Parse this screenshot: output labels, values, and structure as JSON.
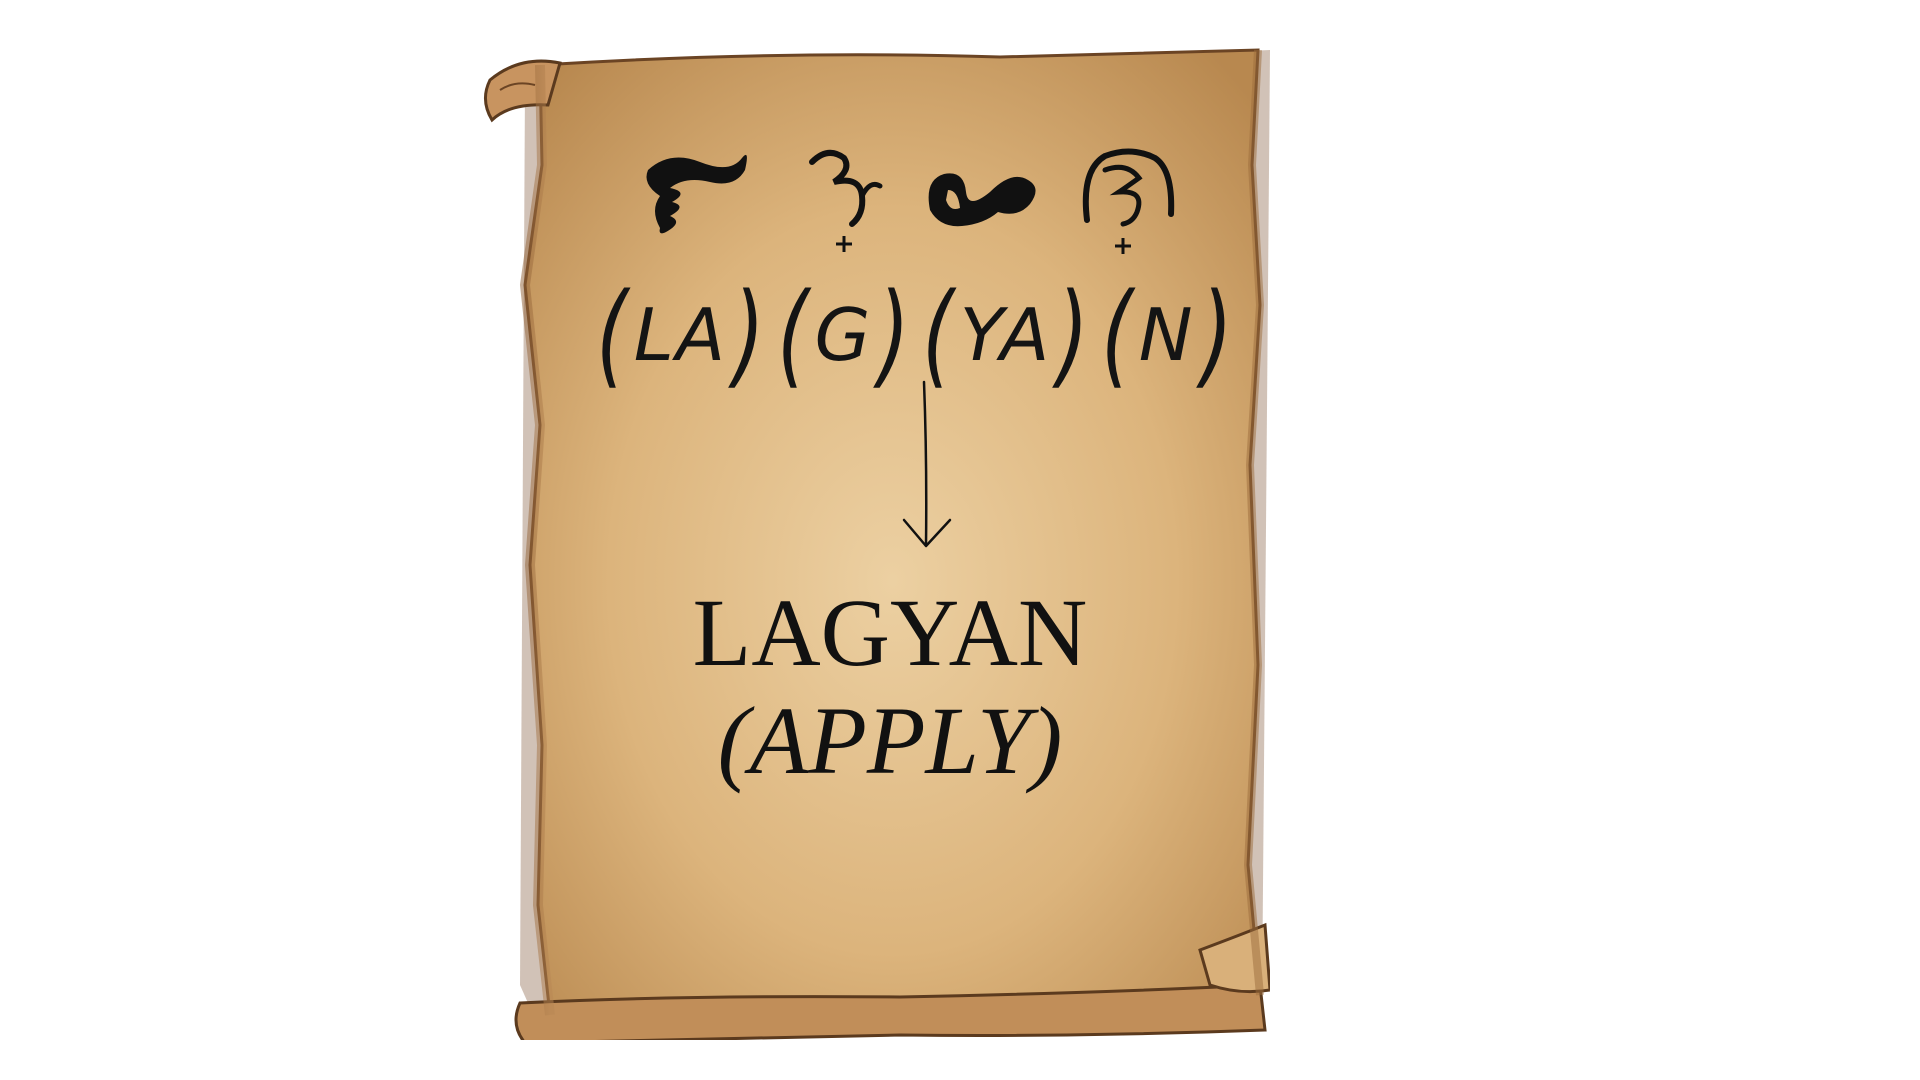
{
  "scroll": {
    "script_glyphs": [
      "la-glyph",
      "ga-glyph-with-cross-kudlit",
      "ya-glyph",
      "na-glyph-with-cross-kudlit"
    ],
    "syllables": [
      "LA",
      "G",
      "YA",
      "N"
    ],
    "paren_open": "(",
    "paren_close": ")",
    "word": "LAGYAN",
    "translation": "(APPLY)",
    "colors": {
      "parchment_light": "#e8c897",
      "parchment_mid": "#d4a96b",
      "parchment_edge": "#a77445",
      "ink": "#111111"
    }
  }
}
